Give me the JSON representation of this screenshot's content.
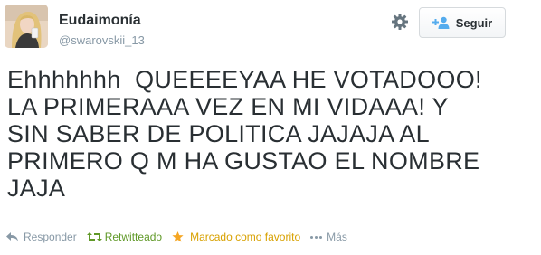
{
  "user": {
    "display_name": "Eudaimonía",
    "handle": "@swarovskii_13"
  },
  "header": {
    "follow_label": "Seguir",
    "gear_icon": "gear-icon",
    "follow_icon": "add-user-icon"
  },
  "tweet": {
    "text": "Ehhhhhhh  QUEEEEYAA HE VOTADOOO!\nLA PRIMERAAA VEZ EN MI VIDAAA! Y\nSIN SABER DE POLITICA JAJAJA AL\nPRIMERO Q M HA GUSTAO EL NOMBRE\nJAJA"
  },
  "actions": {
    "reply_label": "Responder",
    "retweet_label": "Retwitteado",
    "favorite_label": "Marcado como favorito",
    "more_label": "Más",
    "colors": {
      "retweeted": "#609928",
      "favorited": "#f5a623",
      "muted": "#8899a6"
    }
  }
}
